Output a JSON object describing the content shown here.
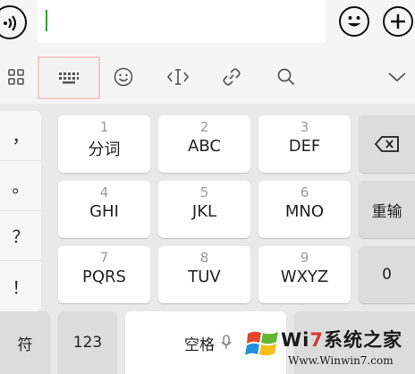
{
  "input": {
    "placeholder": ""
  },
  "toolbar": {
    "icons": [
      "apps-grid-icon",
      "keyboard-icon",
      "emoji-icon",
      "cursor-move-icon",
      "link-icon",
      "search-icon",
      "chevron-down-icon"
    ],
    "active_index": 1,
    "active_border_color": "#f4c9cc"
  },
  "keyboard": {
    "punctuation": [
      "，",
      "。",
      "？",
      "！"
    ],
    "keys": [
      {
        "num": "1",
        "letters": "分词"
      },
      {
        "num": "2",
        "letters": "ABC"
      },
      {
        "num": "3",
        "letters": "DEF"
      },
      {
        "num": "4",
        "letters": "GHI"
      },
      {
        "num": "5",
        "letters": "JKL"
      },
      {
        "num": "6",
        "letters": "MNO"
      },
      {
        "num": "7",
        "letters": "PQRS"
      },
      {
        "num": "8",
        "letters": "TUV"
      },
      {
        "num": "9",
        "letters": "WXYZ"
      }
    ],
    "right_keys": {
      "backspace": "backspace-icon",
      "reenter": "重输",
      "zero": "0"
    },
    "bottom": {
      "symbols": "符",
      "numbers": "123",
      "space": "空格",
      "mic": "mic-icon"
    }
  },
  "watermark": {
    "brand_prefix": "Wi",
    "brand_seven": "7",
    "brand_suffix": "系统之家",
    "url": "Www.Winwin7.com"
  },
  "colors": {
    "caret": "#1aad19",
    "key_bg": "#ffffff",
    "keyboard_bg": "#e9e9e9"
  }
}
